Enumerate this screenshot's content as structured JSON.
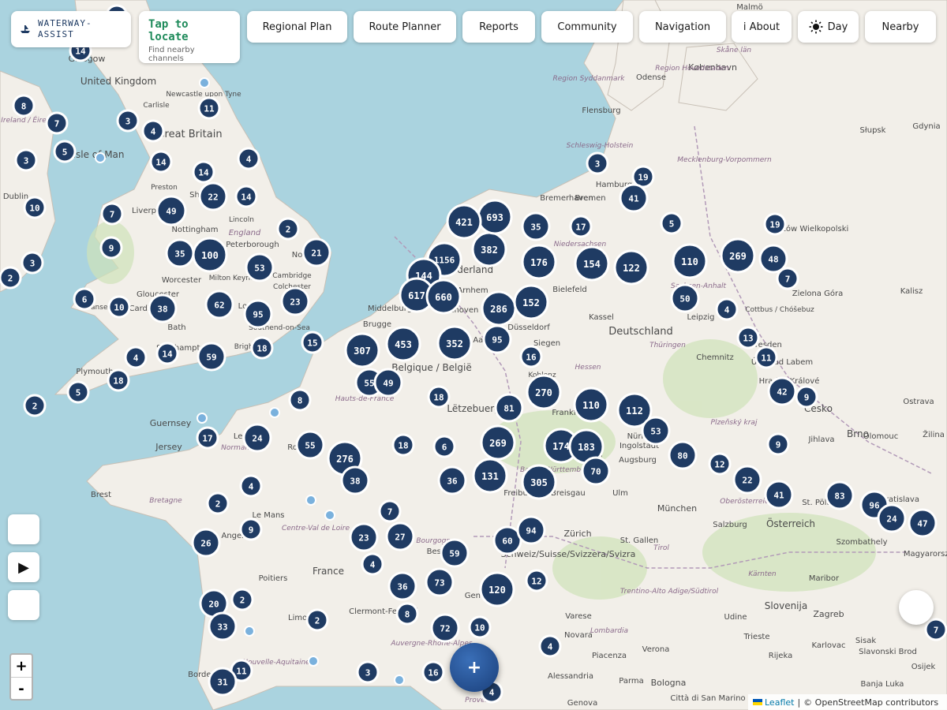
{
  "app": {
    "brand": "WATERWAY-\nASSIST",
    "brand_line1": "WATERWAY-",
    "brand_line2": "ASSIST"
  },
  "locate": {
    "title_line1": "Tap to",
    "title_line2": "locate",
    "subtitle": "Find nearby channels"
  },
  "nav": {
    "regional_plan": "Regional Plan",
    "route_planner": "Route Planner",
    "reports": "Reports",
    "community": "Community",
    "navigation": "Navigation",
    "about": "i About",
    "day": "Day",
    "nearby": "Nearby"
  },
  "controls": {
    "zoom_in": "+",
    "zoom_out": "-",
    "play": "▶",
    "fab": "+"
  },
  "attribution": {
    "leaflet": "Leaflet",
    "separator": "|",
    "osm": "© OpenStreetMap contributors"
  },
  "icons": {
    "brand": "boat-icon",
    "day": "sun-icon",
    "play": "play-icon"
  },
  "colors": {
    "cluster": "#1f3b63",
    "locate_title": "#1e8a5a",
    "water": "#aad3df",
    "land": "#f2efe9"
  },
  "places": [
    {
      "name": "Glasgow"
    },
    {
      "name": "United Kingdom"
    },
    {
      "name": "Newcastle upon Tyne"
    },
    {
      "name": "Carlisle"
    },
    {
      "name": "Great Britain"
    },
    {
      "name": "Isle of Man"
    },
    {
      "name": "Dublin"
    },
    {
      "name": "Preston"
    },
    {
      "name": "Liverpool"
    },
    {
      "name": "Lincoln"
    },
    {
      "name": "England"
    },
    {
      "name": "Nottingham"
    },
    {
      "name": "Peterborough"
    },
    {
      "name": "Norwich"
    },
    {
      "name": "Milton Keynes"
    },
    {
      "name": "Cambridge"
    },
    {
      "name": "Colchester"
    },
    {
      "name": "Worcester"
    },
    {
      "name": "Gloucester"
    },
    {
      "name": "Swansea"
    },
    {
      "name": "Cardiff"
    },
    {
      "name": "Bath"
    },
    {
      "name": "Southend-on-Sea"
    },
    {
      "name": "Southampton"
    },
    {
      "name": "Brighton"
    },
    {
      "name": "Plymouth"
    },
    {
      "name": "Guernsey"
    },
    {
      "name": "Jersey"
    },
    {
      "name": "Le Havre"
    },
    {
      "name": "Rouen"
    },
    {
      "name": "Normandie"
    },
    {
      "name": "Brest"
    },
    {
      "name": "Bretagne"
    },
    {
      "name": "Le Mans"
    },
    {
      "name": "Angers"
    },
    {
      "name": "Centre-Val de Loire"
    },
    {
      "name": "France"
    },
    {
      "name": "Poitiers"
    },
    {
      "name": "Limoges"
    },
    {
      "name": "Clermont-Ferrand"
    },
    {
      "name": "Nouvelle-Aquitaine"
    },
    {
      "name": "Bordeaux"
    },
    {
      "name": "Bourgogne"
    },
    {
      "name": "Besançon"
    },
    {
      "name": "Auvergne-Rhône-Alpes"
    },
    {
      "name": "Genève"
    },
    {
      "name": "Provence"
    },
    {
      "name": "Hauts-de-France"
    },
    {
      "name": "Middelburg"
    },
    {
      "name": "Brugge"
    },
    {
      "name": "Belgique / België"
    },
    {
      "name": "Nederland"
    },
    {
      "name": "Arnhem"
    },
    {
      "name": "Eindhoven"
    },
    {
      "name": "Aachen"
    },
    {
      "name": "Düsseldorf"
    },
    {
      "name": "Siegen"
    },
    {
      "name": "Koblenz"
    },
    {
      "name": "Lëtzebuerg"
    },
    {
      "name": "Hessen"
    },
    {
      "name": "Frankfurt"
    },
    {
      "name": "Karlsruhe"
    },
    {
      "name": "Baden-Württemberg"
    },
    {
      "name": "Freiburg im Breisgau"
    },
    {
      "name": "Zürich"
    },
    {
      "name": "Schweiz/Suisse/Svizzera/Svizra"
    },
    {
      "name": "St. Gallen"
    },
    {
      "name": "Ulm"
    },
    {
      "name": "Augsburg"
    },
    {
      "name": "Ingolstadt"
    },
    {
      "name": "Nürnberg"
    },
    {
      "name": "München"
    },
    {
      "name": "Deutschland"
    },
    {
      "name": "Bielefeld"
    },
    {
      "name": "Kassel"
    },
    {
      "name": "Leipzig"
    },
    {
      "name": "Chemnitz"
    },
    {
      "name": "Dresden"
    },
    {
      "name": "Thüringen"
    },
    {
      "name": "Niedersachsen"
    },
    {
      "name": "Bremen"
    },
    {
      "name": "Bremerhaven"
    },
    {
      "name": "Hamburg"
    },
    {
      "name": "Flensburg"
    },
    {
      "name": "Schleswig-Holstein"
    },
    {
      "name": "Mecklenburg-Vorpommern"
    },
    {
      "name": "København"
    },
    {
      "name": "Odense"
    },
    {
      "name": "Region Syddanmark"
    },
    {
      "name": "Region Hovedstaden"
    },
    {
      "name": "Skåne län"
    },
    {
      "name": "Malmö"
    },
    {
      "name": "Słupsk"
    },
    {
      "name": "Gdynia"
    },
    {
      "name": "Gorzów Wielkopolski"
    },
    {
      "name": "Zielona Góra"
    },
    {
      "name": "Kalisz"
    },
    {
      "name": "Cottbus / Chóšebuz"
    },
    {
      "name": "Sachsen-Anhalt"
    },
    {
      "name": "Ústí nad Labem"
    },
    {
      "name": "Hradec Králové"
    },
    {
      "name": "Česko"
    },
    {
      "name": "Plzeňský kraj"
    },
    {
      "name": "Jihlava"
    },
    {
      "name": "Brno"
    },
    {
      "name": "Olomouc"
    },
    {
      "name": "Ostrava"
    },
    {
      "name": "Žilina"
    },
    {
      "name": "St. Pölten"
    },
    {
      "name": "Bratislava"
    },
    {
      "name": "Österreich"
    },
    {
      "name": "Salzburg"
    },
    {
      "name": "Szombathely"
    },
    {
      "name": "Magyarország"
    },
    {
      "name": "Oberösterreich"
    },
    {
      "name": "Tirol"
    },
    {
      "name": "Kärnten"
    },
    {
      "name": "Maribor"
    },
    {
      "name": "Slovenija"
    },
    {
      "name": "Zagreb"
    },
    {
      "name": "Udine"
    },
    {
      "name": "Trentino-Alto Adige/Südtirol"
    },
    {
      "name": "Lombardia"
    },
    {
      "name": "Varese"
    },
    {
      "name": "Novara"
    },
    {
      "name": "Piacenza"
    },
    {
      "name": "Verona"
    },
    {
      "name": "Trieste"
    },
    {
      "name": "Rijeka"
    },
    {
      "name": "Karlovac"
    },
    {
      "name": "Sisak"
    },
    {
      "name": "Slavonski Brod"
    },
    {
      "name": "Banja Luka"
    },
    {
      "name": "Osijek"
    },
    {
      "name": "Alessandria"
    },
    {
      "name": "Parma"
    },
    {
      "name": "Bologna"
    },
    {
      "name": "Città di San Marino"
    },
    {
      "name": "Genova"
    },
    {
      "name": "Ireland / Éire"
    },
    {
      "name": "Sheffield"
    },
    {
      "name": "London"
    }
  ],
  "clusters": [
    {
      "n": "14"
    },
    {
      "n": "8"
    },
    {
      "n": "7"
    },
    {
      "n": "5"
    },
    {
      "n": "3"
    },
    {
      "n": "10"
    },
    {
      "n": "3"
    },
    {
      "n": "2"
    },
    {
      "n": "3"
    },
    {
      "n": "4"
    },
    {
      "n": "11"
    },
    {
      "n": "14"
    },
    {
      "n": "14"
    },
    {
      "n": "4"
    },
    {
      "n": "22"
    },
    {
      "n": "14"
    },
    {
      "n": "49"
    },
    {
      "n": "7"
    },
    {
      "n": "9"
    },
    {
      "n": "2"
    },
    {
      "n": "35"
    },
    {
      "n": "100"
    },
    {
      "n": "53"
    },
    {
      "n": "21"
    },
    {
      "n": "6"
    },
    {
      "n": "10"
    },
    {
      "n": "38"
    },
    {
      "n": "62"
    },
    {
      "n": "95"
    },
    {
      "n": "23"
    },
    {
      "n": "4"
    },
    {
      "n": "14"
    },
    {
      "n": "59"
    },
    {
      "n": "18"
    },
    {
      "n": "15"
    },
    {
      "n": "18"
    },
    {
      "n": "5"
    },
    {
      "n": "2"
    },
    {
      "n": "8"
    },
    {
      "n": "17"
    },
    {
      "n": "24"
    },
    {
      "n": "55"
    },
    {
      "n": "276"
    },
    {
      "n": "38"
    },
    {
      "n": "4"
    },
    {
      "n": "2"
    },
    {
      "n": "9"
    },
    {
      "n": "26"
    },
    {
      "n": "20"
    },
    {
      "n": "2"
    },
    {
      "n": "33"
    },
    {
      "n": "2"
    },
    {
      "n": "11"
    },
    {
      "n": "31"
    },
    {
      "n": "3"
    },
    {
      "n": "8"
    },
    {
      "n": "16"
    },
    {
      "n": "72"
    },
    {
      "n": "10"
    },
    {
      "n": "4"
    },
    {
      "n": "7"
    },
    {
      "n": "23"
    },
    {
      "n": "27"
    },
    {
      "n": "4"
    },
    {
      "n": "59"
    },
    {
      "n": "36"
    },
    {
      "n": "73"
    },
    {
      "n": "120"
    },
    {
      "n": "12"
    },
    {
      "n": "60"
    },
    {
      "n": "94"
    },
    {
      "n": "4"
    },
    {
      "n": "18"
    },
    {
      "n": "6"
    },
    {
      "n": "36"
    },
    {
      "n": "131"
    },
    {
      "n": "305"
    },
    {
      "n": "269"
    },
    {
      "n": "174"
    },
    {
      "n": "183"
    },
    {
      "n": "70"
    },
    {
      "n": "81"
    },
    {
      "n": "270"
    },
    {
      "n": "110"
    },
    {
      "n": "112"
    },
    {
      "n": "53"
    },
    {
      "n": "80"
    },
    {
      "n": "12"
    },
    {
      "n": "22"
    },
    {
      "n": "41"
    },
    {
      "n": "83"
    },
    {
      "n": "96"
    },
    {
      "n": "24"
    },
    {
      "n": "47"
    },
    {
      "n": "7"
    },
    {
      "n": "9"
    },
    {
      "n": "42"
    },
    {
      "n": "9"
    },
    {
      "n": "11"
    },
    {
      "n": "13"
    },
    {
      "n": "4"
    },
    {
      "n": "50"
    },
    {
      "n": "110"
    },
    {
      "n": "269"
    },
    {
      "n": "48"
    },
    {
      "n": "7"
    },
    {
      "n": "19"
    },
    {
      "n": "5"
    },
    {
      "n": "122"
    },
    {
      "n": "154"
    },
    {
      "n": "176"
    },
    {
      "n": "17"
    },
    {
      "n": "35"
    },
    {
      "n": "382"
    },
    {
      "n": "693"
    },
    {
      "n": "421"
    },
    {
      "n": "1156"
    },
    {
      "n": "144"
    },
    {
      "n": "617"
    },
    {
      "n": "660"
    },
    {
      "n": "286"
    },
    {
      "n": "152"
    },
    {
      "n": "95"
    },
    {
      "n": "16"
    },
    {
      "n": "352"
    },
    {
      "n": "453"
    },
    {
      "n": "307"
    },
    {
      "n": "55"
    },
    {
      "n": "49"
    },
    {
      "n": "18"
    },
    {
      "n": "3"
    },
    {
      "n": "19"
    },
    {
      "n": "41"
    },
    {
      "n": "14"
    }
  ]
}
